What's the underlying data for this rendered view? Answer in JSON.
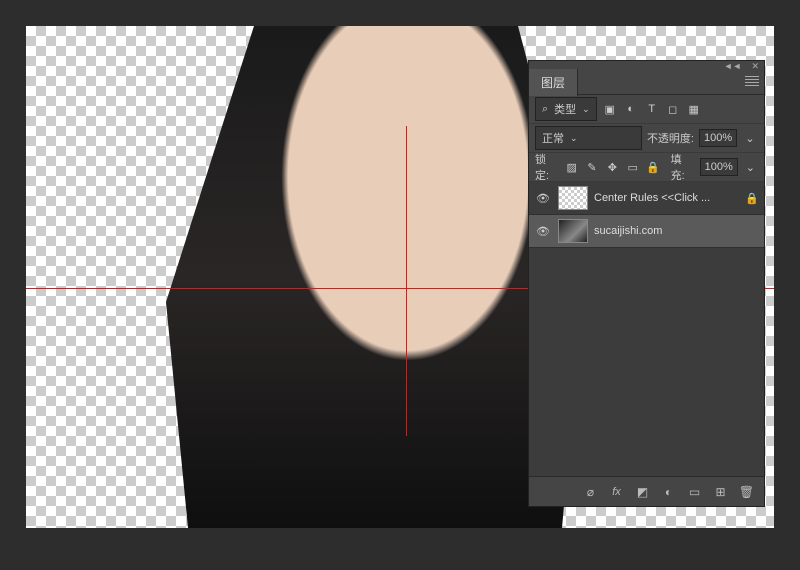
{
  "panel": {
    "title": "图层",
    "filter_label": "类型",
    "blend_mode": "正常",
    "opacity_label": "不透明度:",
    "opacity_value": "100%",
    "lock_label": "锁定:",
    "fill_label": "填充:",
    "fill_value": "100%"
  },
  "layers": [
    {
      "name": "Center Rules <<Click ...",
      "visible": true,
      "locked": true,
      "selected": false
    },
    {
      "name": "sucaijishi.com",
      "visible": true,
      "locked": false,
      "selected": true
    }
  ],
  "footer_icons": [
    "link",
    "fx",
    "mask",
    "adjust",
    "group",
    "new",
    "trash"
  ]
}
